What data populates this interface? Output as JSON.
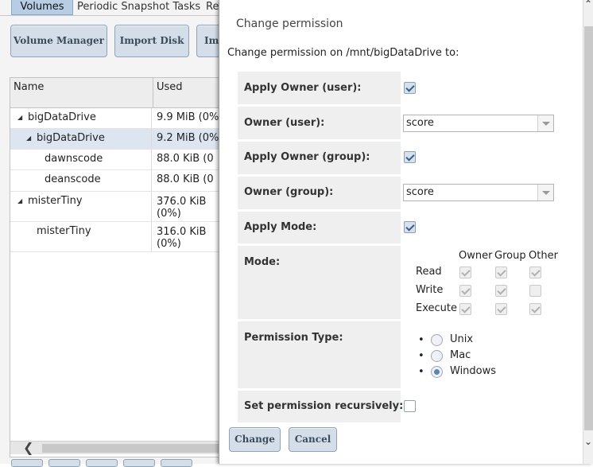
{
  "background": {
    "tabs": [
      "Volumes",
      "Periodic Snapshot Tasks",
      "Re"
    ],
    "toolbar": [
      "Volume Manager",
      "Import Disk",
      "Im"
    ],
    "grid": {
      "columns": [
        "Name",
        "Used"
      ],
      "rows": [
        {
          "name": "bigDataDrive",
          "used": "9.9 MiB (0%"
        },
        {
          "name": "bigDataDrive",
          "used": "9.2 MiB (0%"
        },
        {
          "name": "dawnscode",
          "used": "88.0 KiB (0"
        },
        {
          "name": "deanscode",
          "used": "88.0 KiB (0"
        },
        {
          "name": "misterTiny",
          "used": "376.0 KiB",
          "used2": "(0%)"
        },
        {
          "name": "misterTiny",
          "used": "316.0 KiB",
          "used2": "(0%)"
        }
      ]
    }
  },
  "dialog": {
    "title": "Change permission",
    "description": "Change permission on /mnt/bigDataDrive to:",
    "apply_owner_user_label": "Apply Owner (user):",
    "apply_owner_user_checked": true,
    "owner_user_label": "Owner (user):",
    "owner_user_value": "score",
    "apply_owner_group_label": "Apply Owner (group):",
    "apply_owner_group_checked": true,
    "owner_group_label": "Owner (group):",
    "owner_group_value": "score",
    "apply_mode_label": "Apply Mode:",
    "apply_mode_checked": true,
    "mode_label": "Mode:",
    "mode_columns": [
      "Owner",
      "Group",
      "Other"
    ],
    "mode_rows": [
      {
        "label": "Read",
        "owner": true,
        "group": true,
        "other": true
      },
      {
        "label": "Write",
        "owner": true,
        "group": true,
        "other": false
      },
      {
        "label": "Execute",
        "owner": true,
        "group": true,
        "other": true
      }
    ],
    "permission_type_label": "Permission Type:",
    "permission_types": [
      {
        "label": "Unix",
        "selected": false
      },
      {
        "label": "Mac",
        "selected": false
      },
      {
        "label": "Windows",
        "selected": true
      }
    ],
    "recursive_label": "Set permission recursively:",
    "recursive_checked": false,
    "change_button": "Change",
    "cancel_button": "Cancel"
  }
}
